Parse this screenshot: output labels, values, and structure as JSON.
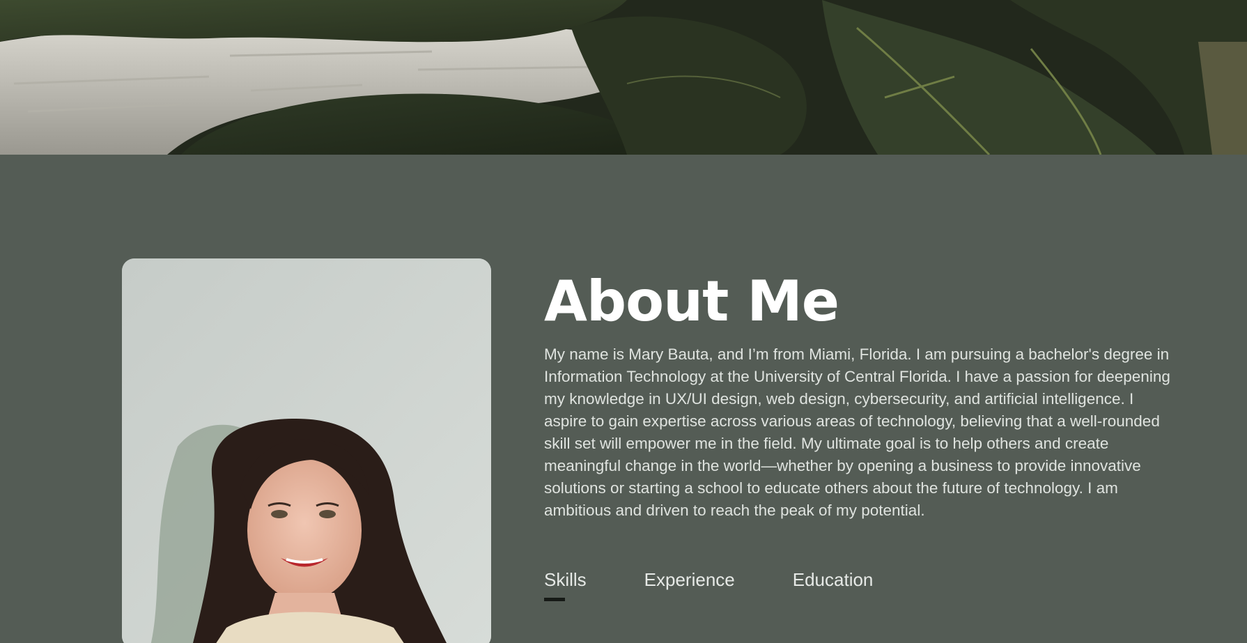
{
  "header": {
    "banner_alt": "plant leaves banner"
  },
  "about": {
    "title": "About Me",
    "paragraph": "My name is Mary Bauta, and I’m from Miami, Florida. I am pursuing a bachelor's degree in Information Technology at the University of Central Florida. I have a passion for deepening my knowledge in UX/UI design, web design, cybersecurity, and artificial intelligence. I aspire to gain expertise across various areas of technology, believing that a well-rounded skill set will empower me in the field. My ultimate goal is to help others and create meaningful change in the world—whether by opening a business to provide innovative solutions or starting a school to educate others about the future of technology. I am ambitious and driven to reach the peak of my potential."
  },
  "tabs": [
    {
      "label": "Skills",
      "active": true
    },
    {
      "label": "Experience",
      "active": false
    },
    {
      "label": "Education",
      "active": false
    }
  ],
  "colors": {
    "background": "#545c55",
    "title": "#ffffff",
    "text": "#dfe3df",
    "tab_underline": "#161a16"
  }
}
